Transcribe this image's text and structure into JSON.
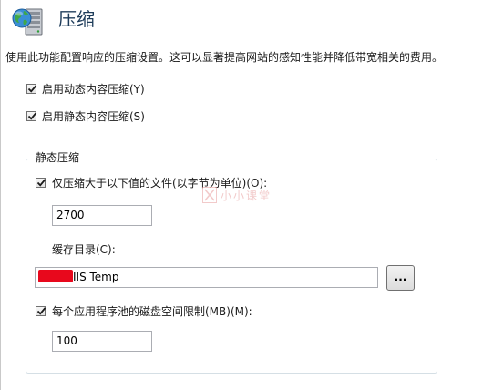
{
  "header": {
    "title": "压缩",
    "icon": "server-globe-icon"
  },
  "description": "使用此功能配置响应的压缩设置。这可以显著提高网站的感知性能并降低带宽相关的费用。",
  "options": {
    "dynamic_compression": {
      "label": "启用动态内容压缩(Y)",
      "checked": true
    },
    "static_compression": {
      "label": "启用静态内容压缩(S)",
      "checked": true
    }
  },
  "static_group": {
    "title": "静态压缩",
    "min_size": {
      "label": "仅压缩大于以下值的文件(以字节为单位)(O):",
      "checked": true,
      "value": "2700"
    },
    "cache_dir": {
      "label": "缓存目录(C):",
      "value": "IIS Temp",
      "browse_label": "..."
    },
    "disk_limit": {
      "label": "每个应用程序池的磁盘空间限制(MB)(M):",
      "checked": true,
      "value": "100"
    }
  },
  "watermark": {
    "text": "小小课堂",
    "icon": "x-logo-icon"
  },
  "colors": {
    "title": "#1e3c5a",
    "redaction": "#e8081c",
    "checkmark": "#1a1a1a"
  }
}
